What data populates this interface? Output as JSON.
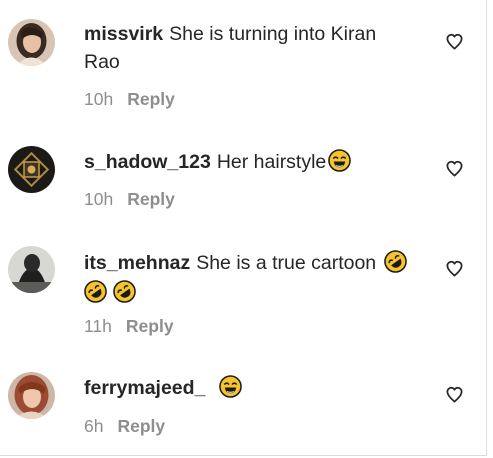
{
  "comments": [
    {
      "username": "missvirk",
      "text": "She is turning into Kiran Rao",
      "time": "10h",
      "reply_label": "Reply",
      "avatar_icon": "profile-photo-woman-dark-hair",
      "emojis": []
    },
    {
      "username": "s_hadow_123",
      "text": "Her hairstyle",
      "time": "10h",
      "reply_label": "Reply",
      "avatar_icon": "profile-photo-dark-ornament",
      "emojis": [
        "laughing-tears-emoji"
      ]
    },
    {
      "username": "its_mehnaz",
      "text": "She is a true cartoon",
      "time": "11h",
      "reply_label": "Reply",
      "avatar_icon": "profile-photo-dark-figure",
      "emojis": [
        "rolling-laughing-emoji",
        "rolling-laughing-emoji",
        "rolling-laughing-emoji"
      ]
    },
    {
      "username": "ferrymajeed_",
      "text": "",
      "time": "6h",
      "reply_label": "Reply",
      "avatar_icon": "profile-photo-woman-reddish-hair",
      "emojis": [
        "laughing-tears-emoji"
      ]
    }
  ],
  "colors": {
    "text": "#262626",
    "secondary": "#8e8e8e",
    "emoji_face": "#f7c32b"
  }
}
